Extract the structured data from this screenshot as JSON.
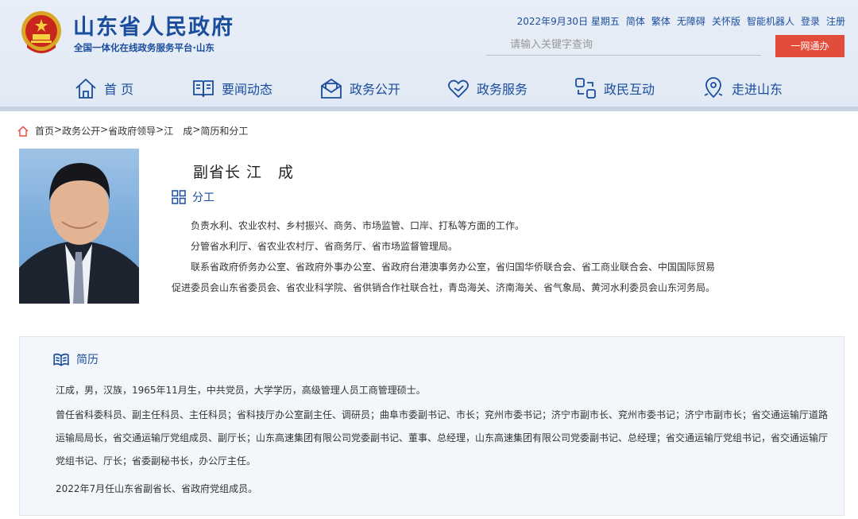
{
  "site": {
    "title": "山东省人民政府",
    "subtitle": "全国一体化在线政务服务平台·山东"
  },
  "top_links": [
    "2022年9月30日 星期五",
    "简体",
    "繁体",
    "无障碍",
    "关怀版",
    "智能机器人",
    "登录",
    "注册"
  ],
  "search": {
    "placeholder": "请输入关键字查询"
  },
  "oneweb_button": "一网通办",
  "nav": [
    {
      "label": "首 页",
      "icon": "home-icon"
    },
    {
      "label": "要闻动态",
      "icon": "book-icon"
    },
    {
      "label": "政务公开",
      "icon": "mail-open-icon"
    },
    {
      "label": "政务服务",
      "icon": "heart-icon"
    },
    {
      "label": "政民互动",
      "icon": "interaction-icon"
    },
    {
      "label": "走进山东",
      "icon": "location-icon"
    }
  ],
  "breadcrumb": [
    "首页",
    "政务公开",
    "省政府领导",
    "江　成",
    "简历和分工"
  ],
  "breadcrumb_sep": ">",
  "profile": {
    "name": "副省长 江　成",
    "duty_title": "分工",
    "duties": [
      "负责水利、农业农村、乡村振兴、商务、市场监管、口岸、打私等方面的工作。",
      "分管省水利厅、省农业农村厅、省商务厅、省市场监督管理局。",
      "联系省政府侨务办公室、省政府外事办公室、省政府台港澳事务办公室，省归国华侨联合会、省工商业联合会、中国国际贸易促进委员会山东省委员会、省农业科学院、省供销合作社联合社，青岛海关、济南海关、省气象局、黄河水利委员会山东河务局。"
    ]
  },
  "resume": {
    "title": "简历",
    "paragraphs": [
      "江成，男，汉族，1965年11月生，中共党员，大学学历，高级管理人员工商管理硕士。",
      "曾任省科委科员、副主任科员、主任科员；省科技厅办公室副主任、调研员；曲阜市委副书记、市长；兖州市委书记；济宁市副市长、兖州市委书记；济宁市副市长；省交通运输厅道路运输局局长，省交通运输厅党组成员、副厅长；山东高速集团有限公司党委副书记、董事、总经理，山东高速集团有限公司党委副书记、总经理；省交通运输厅党组书记，省交通运输厅党组书记、厅长；省委副秘书长，办公厅主任。",
      "2022年7月任山东省副省长、省政府党组成员。"
    ]
  },
  "colors": {
    "brand": "#1a4d9e",
    "accent": "#e14c3b",
    "header_bg": "#e4ebf5",
    "panel_bg": "#f3f6fa"
  }
}
